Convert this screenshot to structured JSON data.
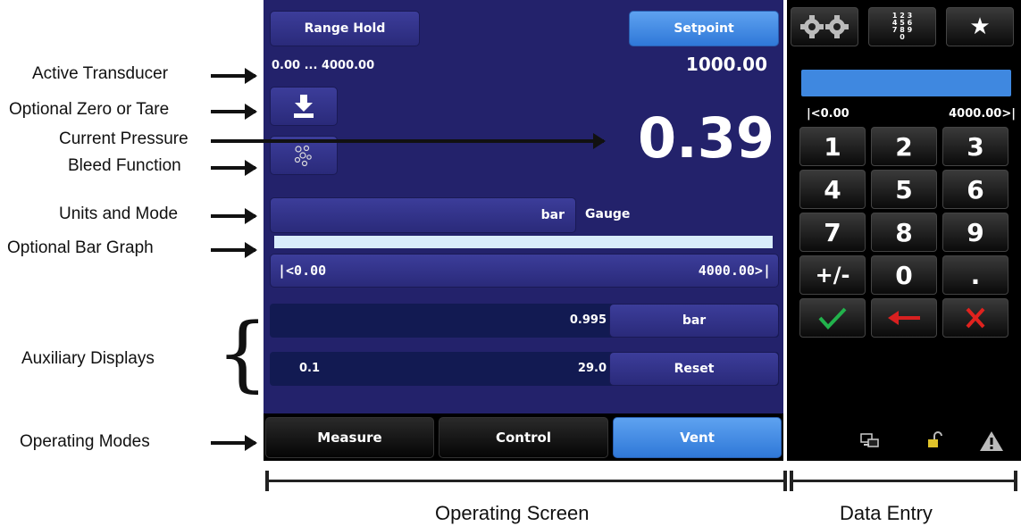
{
  "annotations": {
    "active_transducer": "Active Transducer",
    "zero_tare": "Optional Zero or Tare",
    "current_pressure": "Current Pressure",
    "bleed_function": "Bleed Function",
    "units_mode": "Units and Mode",
    "bar_graph": "Optional Bar Graph",
    "auxiliary_displays": "Auxiliary Displays",
    "operating_modes": "Operating Modes"
  },
  "captions": {
    "operating_screen": "Operating Screen",
    "data_entry": "Data Entry"
  },
  "screen": {
    "range_hold_label": "Range Hold",
    "setpoint_label": "Setpoint",
    "range_text": "0.00 ... 4000.00",
    "setpoint_value": "1000.00",
    "current_pressure": "0.39",
    "unit": "bar",
    "mode": "Gauge",
    "bar_min": "|<0.00",
    "bar_max": "4000.00>|",
    "bar_fill_fraction": 0.0001,
    "aux1_value": "0.995",
    "aux1_button": "bar",
    "aux2_left": "0.1",
    "aux2_value": "29.0",
    "aux2_button": "Reset"
  },
  "modes": {
    "measure": "Measure",
    "control": "Control",
    "vent": "Vent",
    "active": "Vent"
  },
  "data_entry": {
    "range_min": "|<0.00",
    "range_max": "4000.00>|",
    "keys": [
      "1",
      "2",
      "3",
      "4",
      "5",
      "6",
      "7",
      "8",
      "9",
      "+/-",
      "0",
      "."
    ],
    "numpad_icon_text": "1 2 3\n4 5 6\n7 8 9\n0"
  },
  "colors": {
    "screen_bg": "#23226b",
    "accent_blue": "#3f88e0",
    "ok_green": "#22b24c",
    "cancel_red": "#e0221e",
    "back_red": "#d82020"
  }
}
